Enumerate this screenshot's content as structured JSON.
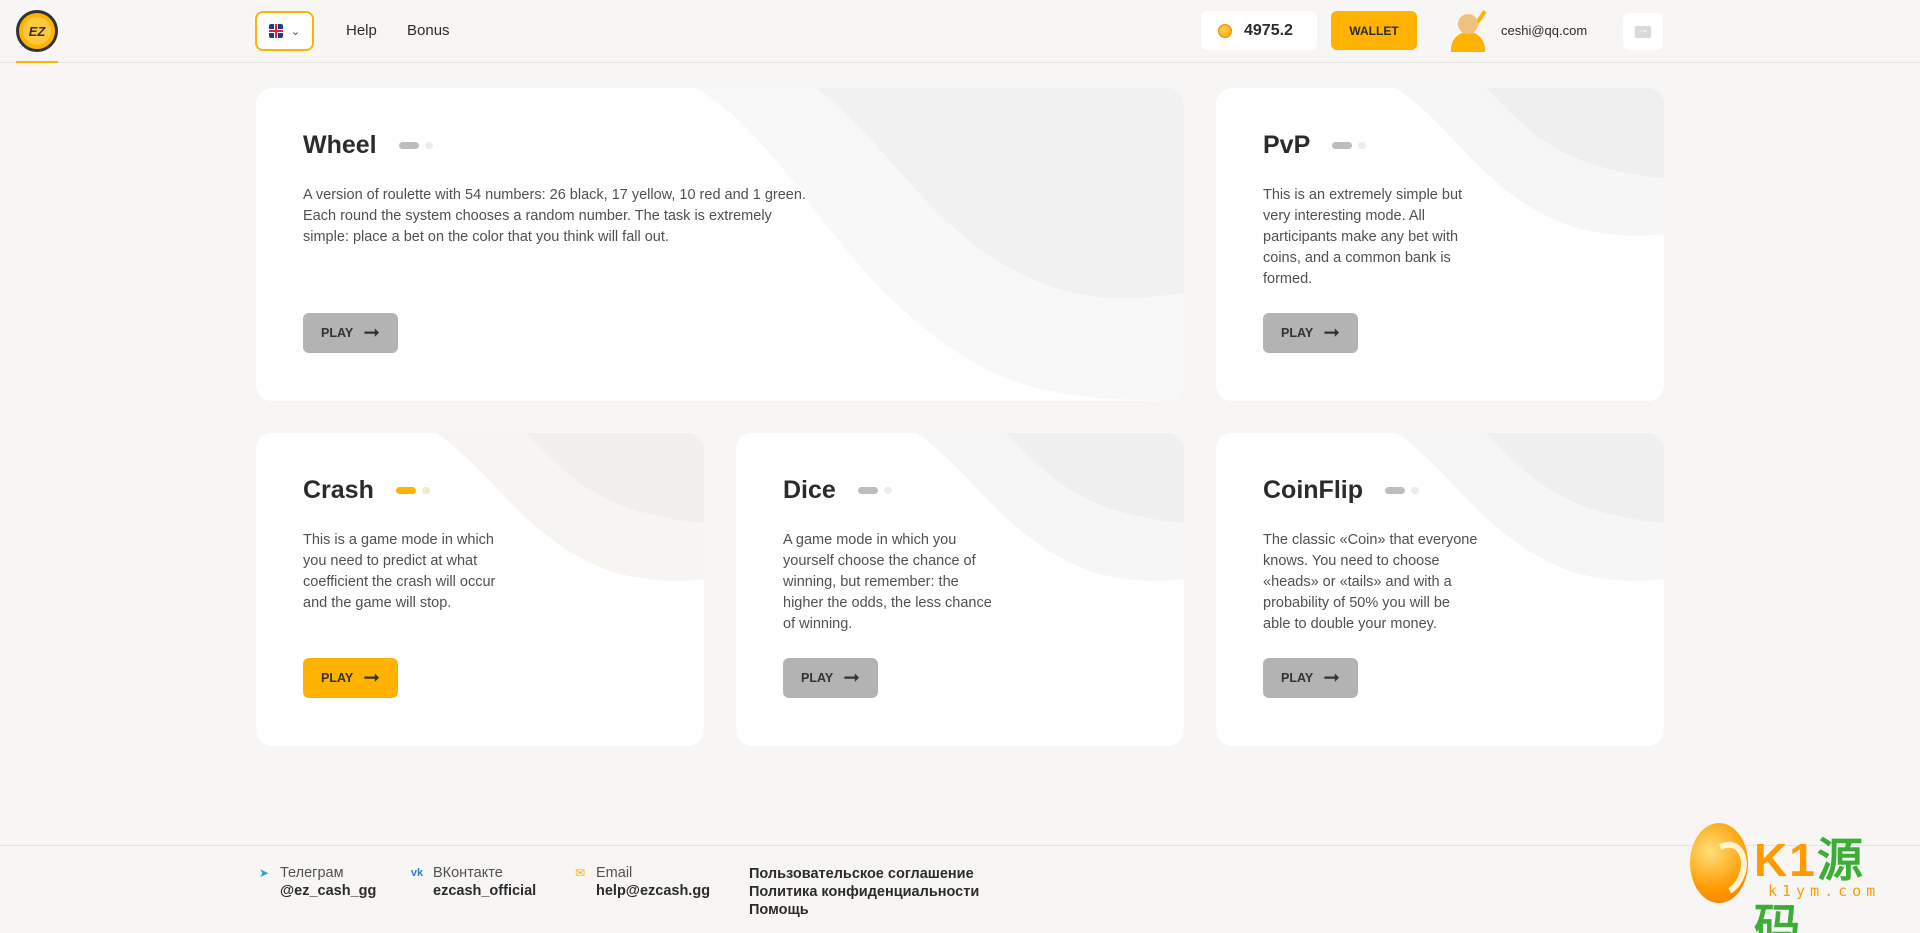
{
  "header": {
    "logo_text": "EZ",
    "nav": {
      "help": "Help",
      "bonus": "Bonus"
    },
    "balance": "4975.2",
    "wallet_label": "WALLET",
    "user_email": "ceshi@qq.com"
  },
  "games": {
    "wheel": {
      "title": "Wheel",
      "desc_lines": [
        "A version of roulette with 54 numbers: 26 black, 17 yellow, 10 red and 1 green.",
        "Each round the system chooses a random number. The task is extremely",
        "simple: place a bet on the color that you think will fall out."
      ],
      "play": "PLAY",
      "active": false
    },
    "pvp": {
      "title": "PvP",
      "desc_lines": [
        "This is an extremely simple but",
        "very interesting mode. All",
        "participants make any bet with",
        "coins, and a common bank is",
        "formed."
      ],
      "play": "PLAY",
      "active": false
    },
    "crash": {
      "title": "Crash",
      "desc_lines": [
        "This is a game mode in which",
        "you need to predict at what",
        "coefficient the crash will occur",
        "and the game will stop."
      ],
      "play": "PLAY",
      "active": true
    },
    "dice": {
      "title": "Dice",
      "desc_lines": [
        "A game mode in which you",
        "yourself choose the chance of",
        "winning, but remember: the",
        "higher the odds, the less chance",
        "of winning."
      ],
      "play": "PLAY",
      "active": false
    },
    "coinflip": {
      "title": "CoinFlip",
      "desc_lines": [
        "The classic «Coin» that everyone",
        "knows. You need to choose",
        "«heads» or «tails» and with a",
        "probability of 50% you will be",
        "able to double your money."
      ],
      "play": "PLAY",
      "active": false
    }
  },
  "footer": {
    "telegram": {
      "label": "Телеграм",
      "value": "@ez_cash_gg"
    },
    "vk": {
      "label": "ВКонтакте",
      "value": "ezcash_official"
    },
    "email": {
      "label": "Email",
      "value": "help@ezcash.gg"
    },
    "links": [
      "Пользовательское соглашение",
      "Политика конфиденциальности",
      "Помощь"
    ]
  },
  "watermark": {
    "title_a": "K1",
    "title_b": "源码",
    "sub": "k1ym.com"
  },
  "colors": {
    "accent": "#ffb300",
    "background": "#f7f6f4",
    "card": "#ffffff",
    "button_inactive": "#b3b3b3"
  }
}
